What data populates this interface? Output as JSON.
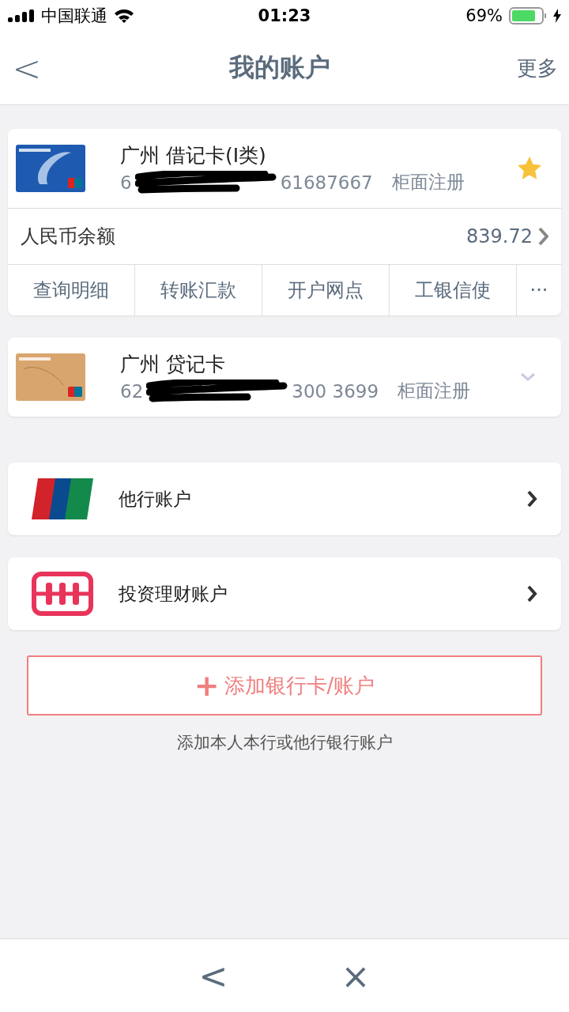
{
  "status_bar": {
    "carrier": "中国联通",
    "time": "01:23",
    "battery": "69%",
    "charging": true
  },
  "nav": {
    "back": "<",
    "title": "我的账户",
    "more": "更多"
  },
  "cards": [
    {
      "kind": "debit",
      "name": "广州 借记卡(I类)",
      "number_start": "6",
      "number_end": "61687667",
      "note": "柜面注册",
      "favorite": true,
      "expanded": true,
      "balance_label": "人民币余额",
      "balance": "839.72",
      "actions": [
        "查询明细",
        "转账汇款",
        "开户网点",
        "工银信使",
        "···"
      ]
    },
    {
      "kind": "credit",
      "name": "广州 贷记卡",
      "number_start": "62",
      "number_end": "300 3699",
      "note": "柜面注册",
      "favorite": false,
      "expanded": false
    }
  ],
  "links": [
    {
      "kind": "unionpay",
      "label": "他行账户"
    },
    {
      "kind": "invest",
      "label": "投资理财账户"
    }
  ],
  "add_button": {
    "icon": "+",
    "label": "添加银行卡/账户"
  },
  "hint": "添加本人本行或他行银行账户",
  "bottom_bar": {
    "back": "<",
    "close": "×"
  }
}
